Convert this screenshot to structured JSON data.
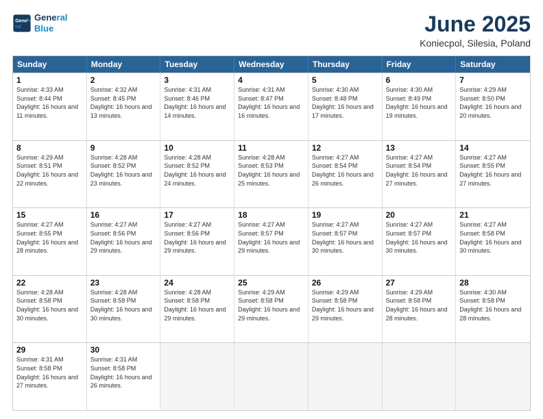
{
  "logo": {
    "line1": "General",
    "line2": "Blue"
  },
  "title": "June 2025",
  "subtitle": "Koniecpol, Silesia, Poland",
  "header_days": [
    "Sunday",
    "Monday",
    "Tuesday",
    "Wednesday",
    "Thursday",
    "Friday",
    "Saturday"
  ],
  "weeks": [
    [
      {
        "day": "1",
        "rise": "4:33 AM",
        "set": "8:44 PM",
        "hours": "16 hours and 11 minutes"
      },
      {
        "day": "2",
        "rise": "4:32 AM",
        "set": "8:45 PM",
        "hours": "16 hours and 13 minutes"
      },
      {
        "day": "3",
        "rise": "4:31 AM",
        "set": "8:46 PM",
        "hours": "16 hours and 14 minutes"
      },
      {
        "day": "4",
        "rise": "4:31 AM",
        "set": "8:47 PM",
        "hours": "16 hours and 16 minutes"
      },
      {
        "day": "5",
        "rise": "4:30 AM",
        "set": "8:48 PM",
        "hours": "16 hours and 17 minutes"
      },
      {
        "day": "6",
        "rise": "4:30 AM",
        "set": "8:49 PM",
        "hours": "16 hours and 19 minutes"
      },
      {
        "day": "7",
        "rise": "4:29 AM",
        "set": "8:50 PM",
        "hours": "16 hours and 20 minutes"
      }
    ],
    [
      {
        "day": "8",
        "rise": "4:29 AM",
        "set": "8:51 PM",
        "hours": "16 hours and 22 minutes"
      },
      {
        "day": "9",
        "rise": "4:28 AM",
        "set": "8:52 PM",
        "hours": "16 hours and 23 minutes"
      },
      {
        "day": "10",
        "rise": "4:28 AM",
        "set": "8:52 PM",
        "hours": "16 hours and 24 minutes"
      },
      {
        "day": "11",
        "rise": "4:28 AM",
        "set": "8:53 PM",
        "hours": "16 hours and 25 minutes"
      },
      {
        "day": "12",
        "rise": "4:27 AM",
        "set": "8:54 PM",
        "hours": "16 hours and 26 minutes"
      },
      {
        "day": "13",
        "rise": "4:27 AM",
        "set": "8:54 PM",
        "hours": "16 hours and 27 minutes"
      },
      {
        "day": "14",
        "rise": "4:27 AM",
        "set": "8:55 PM",
        "hours": "16 hours and 27 minutes"
      }
    ],
    [
      {
        "day": "15",
        "rise": "4:27 AM",
        "set": "8:55 PM",
        "hours": "16 hours and 28 minutes"
      },
      {
        "day": "16",
        "rise": "4:27 AM",
        "set": "8:56 PM",
        "hours": "16 hours and 29 minutes"
      },
      {
        "day": "17",
        "rise": "4:27 AM",
        "set": "8:56 PM",
        "hours": "16 hours and 29 minutes"
      },
      {
        "day": "18",
        "rise": "4:27 AM",
        "set": "8:57 PM",
        "hours": "16 hours and 29 minutes"
      },
      {
        "day": "19",
        "rise": "4:27 AM",
        "set": "8:57 PM",
        "hours": "16 hours and 30 minutes"
      },
      {
        "day": "20",
        "rise": "4:27 AM",
        "set": "8:57 PM",
        "hours": "16 hours and 30 minutes"
      },
      {
        "day": "21",
        "rise": "4:27 AM",
        "set": "8:58 PM",
        "hours": "16 hours and 30 minutes"
      }
    ],
    [
      {
        "day": "22",
        "rise": "4:28 AM",
        "set": "8:58 PM",
        "hours": "16 hours and 30 minutes"
      },
      {
        "day": "23",
        "rise": "4:28 AM",
        "set": "8:58 PM",
        "hours": "16 hours and 30 minutes"
      },
      {
        "day": "24",
        "rise": "4:28 AM",
        "set": "8:58 PM",
        "hours": "16 hours and 29 minutes"
      },
      {
        "day": "25",
        "rise": "4:29 AM",
        "set": "8:58 PM",
        "hours": "16 hours and 29 minutes"
      },
      {
        "day": "26",
        "rise": "4:29 AM",
        "set": "8:58 PM",
        "hours": "16 hours and 29 minutes"
      },
      {
        "day": "27",
        "rise": "4:29 AM",
        "set": "8:58 PM",
        "hours": "16 hours and 28 minutes"
      },
      {
        "day": "28",
        "rise": "4:30 AM",
        "set": "8:58 PM",
        "hours": "16 hours and 28 minutes"
      }
    ],
    [
      {
        "day": "29",
        "rise": "4:31 AM",
        "set": "8:58 PM",
        "hours": "16 hours and 27 minutes"
      },
      {
        "day": "30",
        "rise": "4:31 AM",
        "set": "8:58 PM",
        "hours": "16 hours and 26 minutes"
      },
      null,
      null,
      null,
      null,
      null
    ]
  ]
}
